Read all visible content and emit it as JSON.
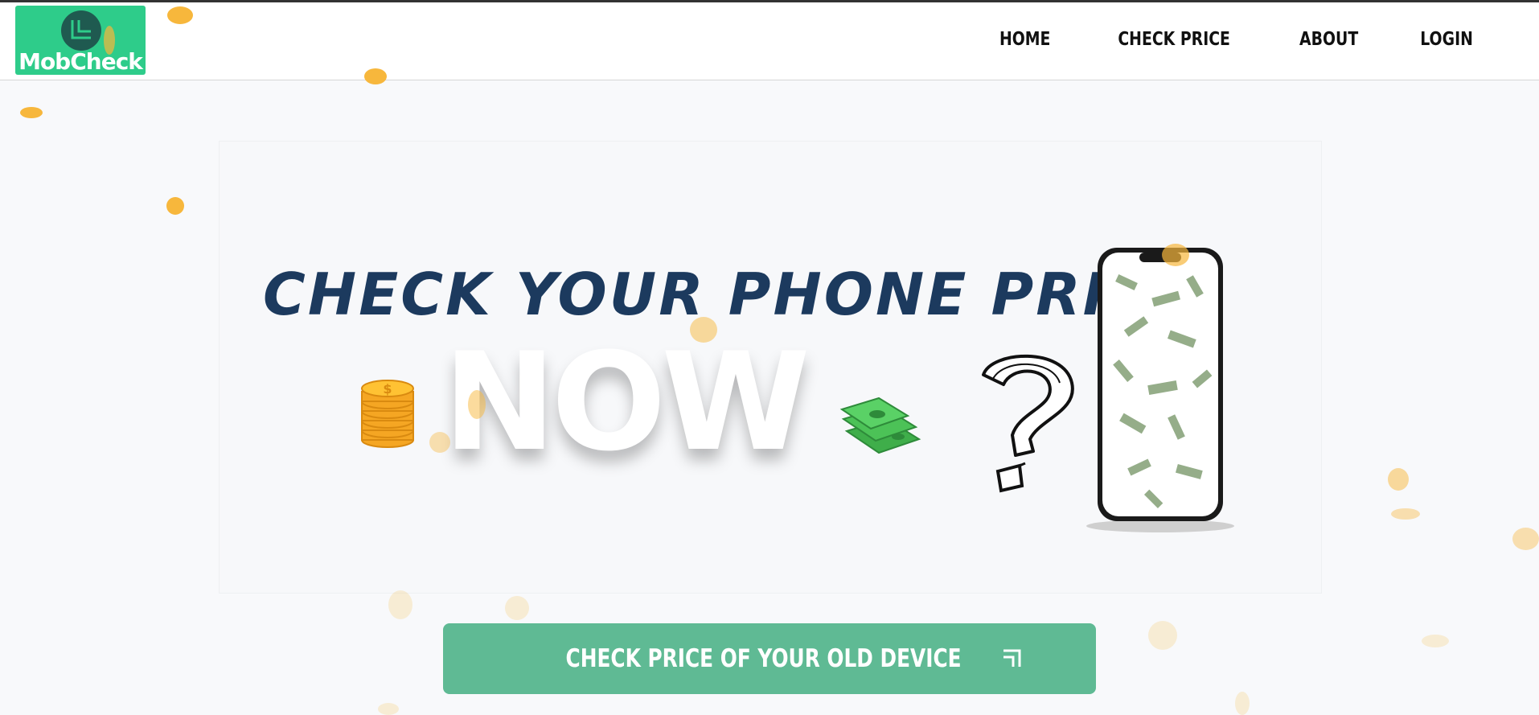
{
  "brand": {
    "name": "MobCheck",
    "logo_color": "#2ecc8a"
  },
  "nav": {
    "items": [
      {
        "label": "HOME"
      },
      {
        "label": "CHECK PRICE"
      },
      {
        "label": "ABOUT"
      },
      {
        "label": "LOGIN"
      }
    ]
  },
  "hero": {
    "headline": "CHECK YOUR PHONE PRICE",
    "emphasis": "NOW",
    "headline_color": "#1c3a5e"
  },
  "cta": {
    "label": "CHECK PRICE OF YOUR OLD DEVICE",
    "icon": "arrow-up-right-icon",
    "color": "#5fba94"
  },
  "decor": {
    "dot_color": "#f7b73c",
    "icons": [
      "coin-stack-icon",
      "cash-stack-icon",
      "question-mark-icon",
      "smartphone-icon"
    ]
  }
}
